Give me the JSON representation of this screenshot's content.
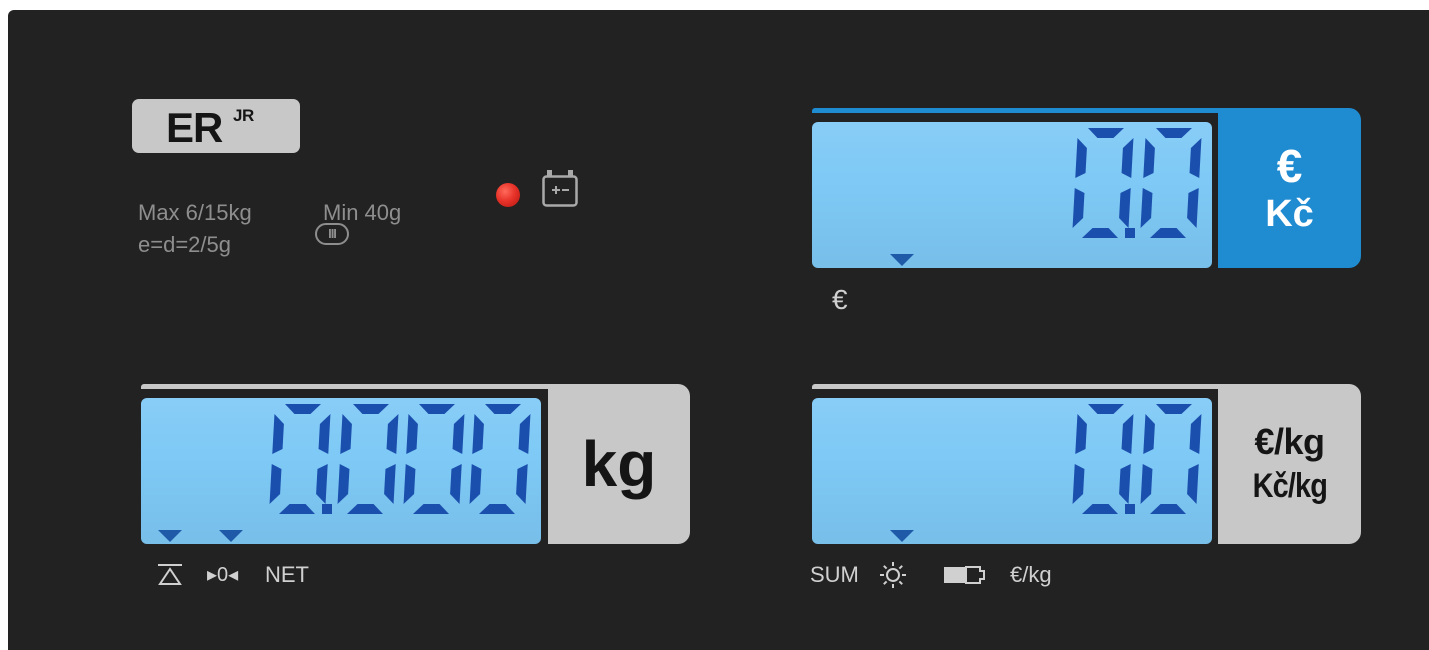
{
  "brand": {
    "name": "ER",
    "superscript": "JR"
  },
  "specs": {
    "line1_max": "Max 6/15kg",
    "line1_min": "Min 40g",
    "line2": "e=d=2/5g",
    "accuracy_class": "III"
  },
  "indicators": {
    "power_led": "red-led",
    "battery": "battery-icon"
  },
  "displays": {
    "price": {
      "value": "0.0",
      "unit_1": "€",
      "unit_2": "Kč",
      "caption": "€",
      "panel_color": "#1f8bd1"
    },
    "weight": {
      "value": "0.000",
      "unit": "kg",
      "panel_color": "#c8c8c8"
    },
    "unit_price": {
      "value": "0.0",
      "unit_1": "€/kg",
      "unit_2": "Kč/kg",
      "panel_color": "#c8c8c8"
    }
  },
  "weight_captions": {
    "zero": "▸0◂",
    "net": "NET"
  },
  "unit_price_captions": {
    "sum": "SUM",
    "unit": "€/kg"
  },
  "colors": {
    "lcd": "#7ec9f6",
    "segments": "#1b4fae",
    "panel": "#222222"
  }
}
